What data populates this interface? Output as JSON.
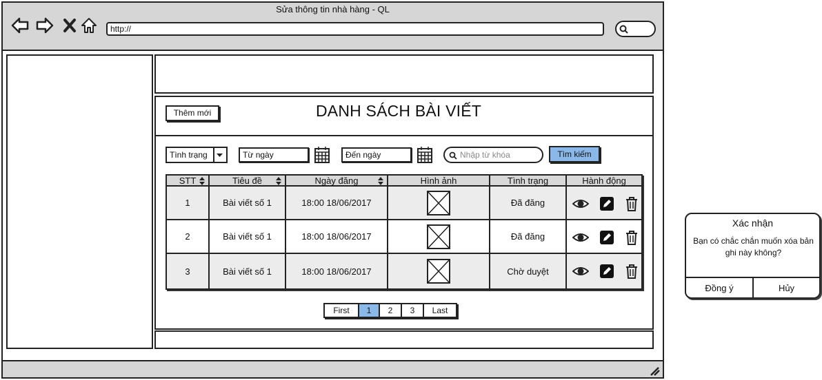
{
  "window": {
    "title": "Sửa thông tin nhà hàng - QL",
    "url": "http://"
  },
  "nav": {
    "back_icon": "arrow-left-icon",
    "forward_icon": "arrow-right-icon",
    "stop_icon": "close-icon",
    "home_icon": "home-icon",
    "search_icon": "search-icon"
  },
  "toolbar": {
    "add_label": "Thêm mới",
    "title": "DANH SÁCH BÀI VIẾT"
  },
  "filters": {
    "status_label": "Tình trạng",
    "from_date": "Từ ngày",
    "to_date": "Đến ngày",
    "keyword_placeholder": "Nhập từ khóa",
    "search_label": "Tìm kiếm"
  },
  "table": {
    "columns": [
      "STT",
      "Tiêu đề",
      "Ngày đăng",
      "Hình ảnh",
      "Tình trạng",
      "Hành động"
    ],
    "rows": [
      {
        "stt": "1",
        "title": "Bài viết số 1",
        "date": "18:00 18/06/2017",
        "status": "Đã đăng"
      },
      {
        "stt": "2",
        "title": "Bài viết số 1",
        "date": "18:00 18/06/2017",
        "status": "Đã đăng"
      },
      {
        "stt": "3",
        "title": "Bài viết số 1",
        "date": "18:00 18/06/2017",
        "status": "Chờ duyệt"
      }
    ]
  },
  "pagination": {
    "first": "First",
    "pages": [
      "1",
      "2",
      "3"
    ],
    "last": "Last",
    "active": "1"
  },
  "dialog": {
    "title": "Xác nhận",
    "message": "Bạn có chắc chắn muốn xóa bản ghi này không?",
    "ok": "Đồng ý",
    "cancel": "Hủy"
  },
  "colors": {
    "accent": "#8ab8e8",
    "chrome": "#d6d6d6",
    "table_header": "#d8d8d8",
    "row_alt": "#ececec"
  }
}
